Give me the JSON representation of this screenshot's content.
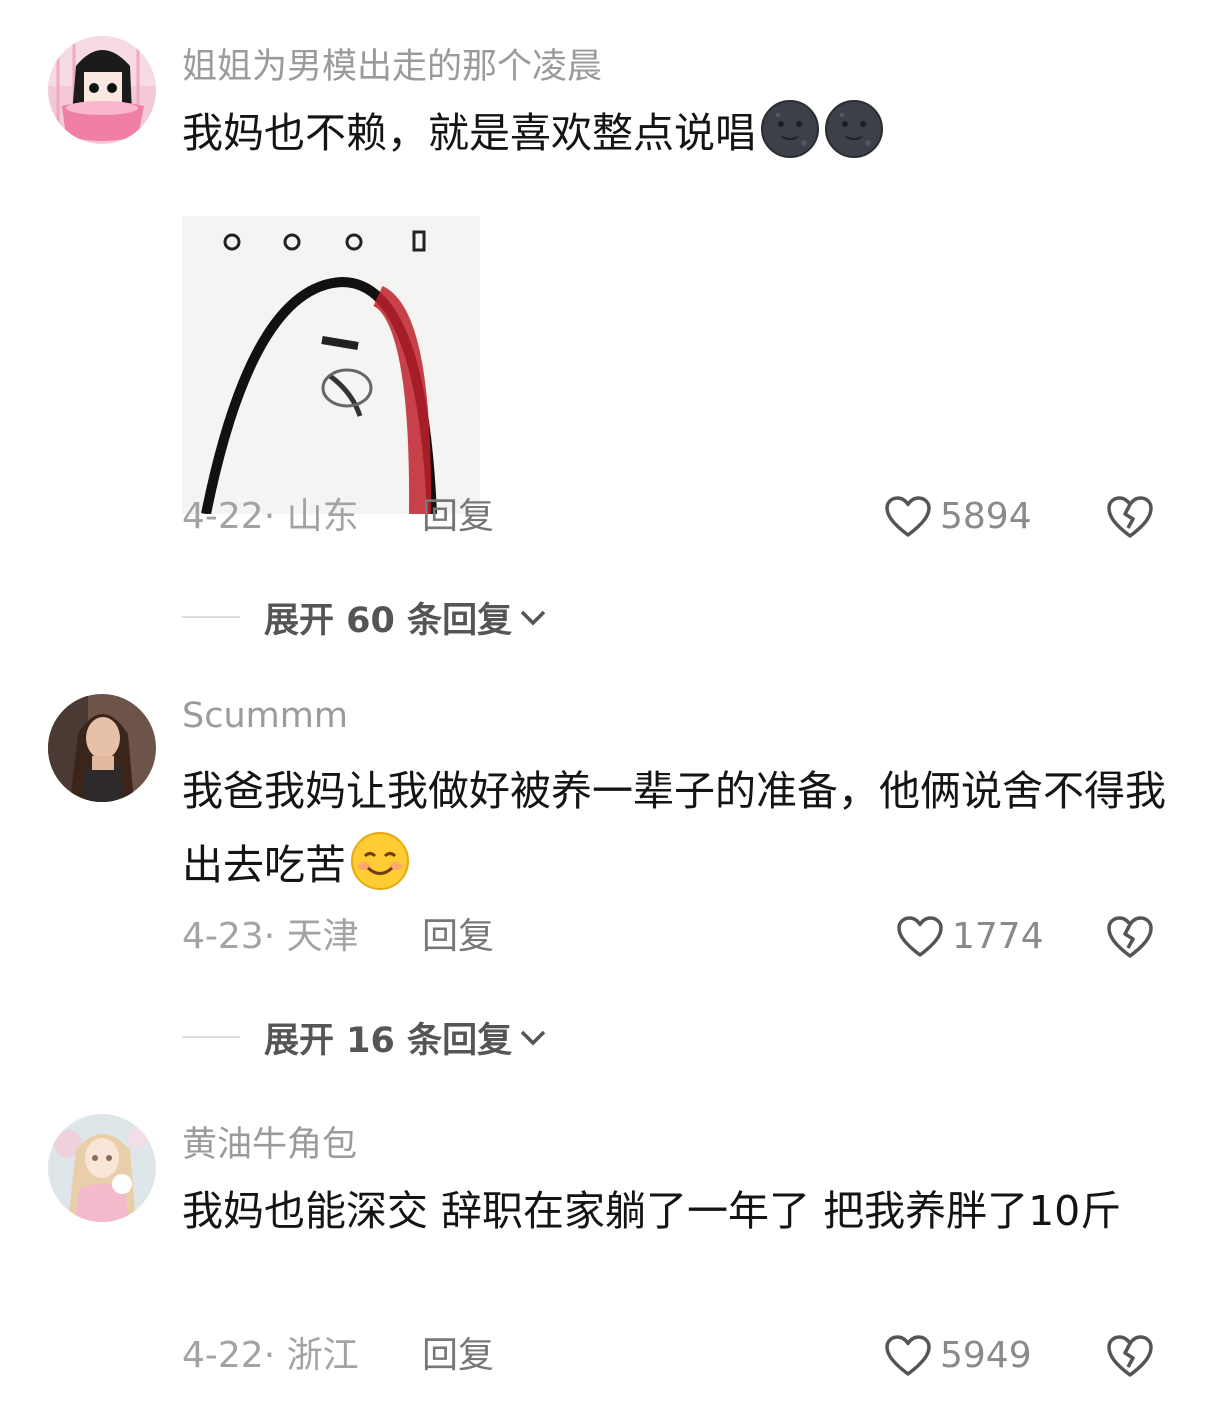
{
  "comments": [
    {
      "username": "姐姐为男模出走的那个凌晨",
      "text": "我妈也不赖，就是喜欢整点说唱",
      "emojis": [
        "new-moon-face-emoji",
        "new-moon-face-emoji"
      ],
      "has_image": true,
      "date_location": "4-22· 山东",
      "reply_label": "回复",
      "likes": "5894",
      "expand_label": "展开 60 条回复"
    },
    {
      "username": "Scummm",
      "text": "我爸我妈让我做好被养一辈子的准备，他俩说舍不得我出去吃苦",
      "emojis": [
        "smiling-face-emoji"
      ],
      "has_image": false,
      "date_location": "4-23· 天津",
      "reply_label": "回复",
      "likes": "1774",
      "expand_label": "展开 16 条回复"
    },
    {
      "username": "黄油牛角包",
      "text": "我妈也能深交 辞职在家躺了一年了 把我养胖了10斤",
      "emojis": [],
      "has_image": false,
      "date_location": "4-22· 浙江",
      "reply_label": "回复",
      "likes": "5949"
    }
  ],
  "icons": {
    "like": "heart-outline-icon",
    "dislike": "broken-heart-icon",
    "expand": "chevron-down-icon"
  },
  "colors": {
    "username": "#9b9b9b",
    "meta": "#a3a3a3",
    "text": "#141414"
  }
}
